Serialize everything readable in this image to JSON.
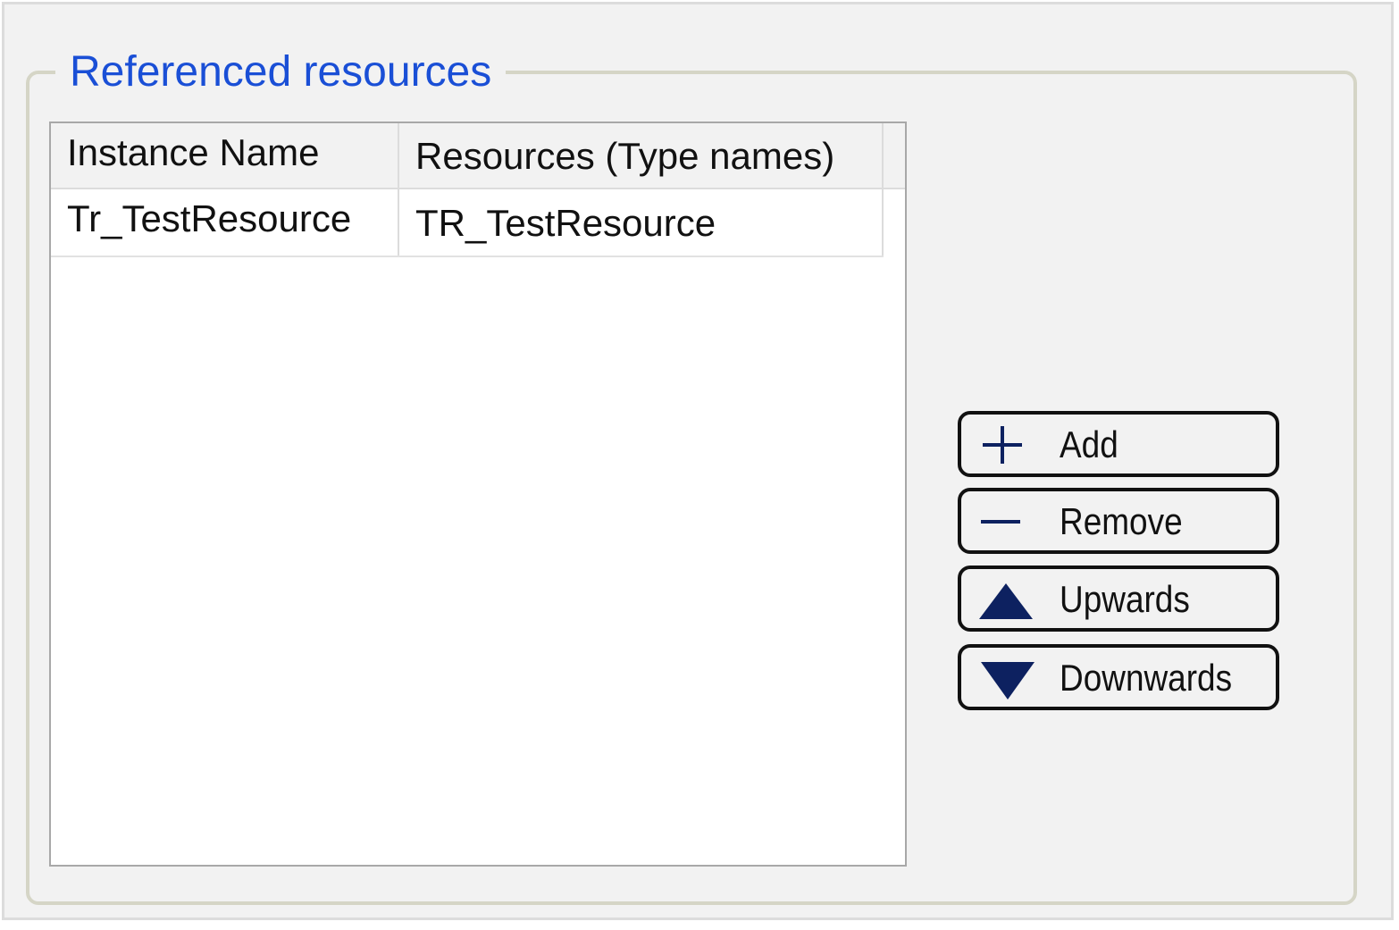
{
  "group": {
    "title": "Referenced resources"
  },
  "table": {
    "columns": [
      "Instance Name",
      "Resources (Type names)"
    ],
    "rows": [
      [
        "Tr_TestResource",
        "TR_TestResource"
      ]
    ]
  },
  "buttons": {
    "add": {
      "label": "Add",
      "icon": "plus-icon"
    },
    "remove": {
      "label": "Remove",
      "icon": "minus-icon"
    },
    "upwards": {
      "label": "Upwards",
      "icon": "triangle-up-icon"
    },
    "downwards": {
      "label": "Downwards",
      "icon": "triangle-down-icon"
    }
  },
  "colors": {
    "title": "#1a4fd6",
    "icon": "#0d2160",
    "background": "#f2f2f2"
  }
}
